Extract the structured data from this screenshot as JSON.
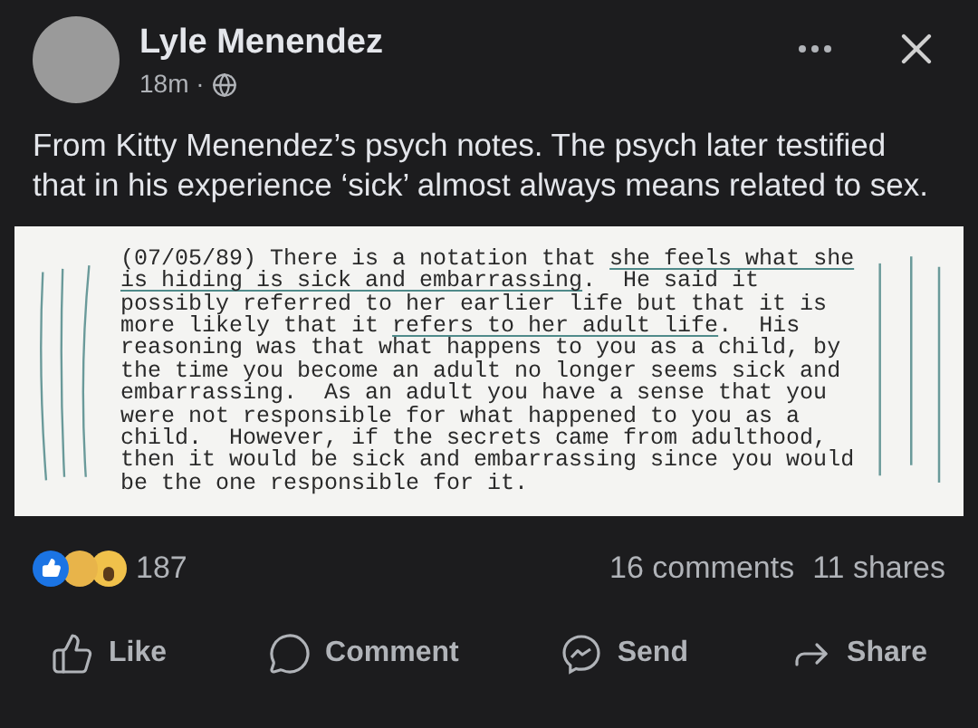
{
  "post": {
    "author": "Lyle Menendez",
    "time": "18m ·",
    "text": "From Kitty Menendez’s psych notes.  The psych later testified that in his experience ‘sick’ almost always means related to sex."
  },
  "document": {
    "lines": [
      [
        {
          "text": "(07/05/89) There is a notation that ",
          "underlined": false
        },
        {
          "text": "she feels what she",
          "underlined": true
        }
      ],
      [
        {
          "text": "is hiding is sick and embarrassing",
          "underlined": true
        },
        {
          "text": ".  He said it",
          "underlined": false
        }
      ],
      [
        {
          "text": "possibly referred to her earlier life but that it is",
          "underlined": false
        }
      ],
      [
        {
          "text": "more likely that it ",
          "underlined": false
        },
        {
          "text": "refers to her adult life",
          "underlined": true
        },
        {
          "text": ".  His",
          "underlined": false
        }
      ],
      [
        {
          "text": "reasoning was that what happens to you as a child, by",
          "underlined": false
        }
      ],
      [
        {
          "text": "the time you become an adult no longer seems sick and",
          "underlined": false
        }
      ],
      [
        {
          "text": "embarrassing.  As an adult you have a sense that you",
          "underlined": false
        }
      ],
      [
        {
          "text": "were not responsible for what happened to you as a",
          "underlined": false
        }
      ],
      [
        {
          "text": "child.  However, if the secrets came from adulthood,",
          "underlined": false
        }
      ],
      [
        {
          "text": "then it would be sick and embarrassing since you would",
          "underlined": false
        }
      ],
      [
        {
          "text": "be the one responsible for it.",
          "underlined": false
        }
      ]
    ]
  },
  "stats": {
    "reactions": "187",
    "comments": "16 comments",
    "shares": "11 shares"
  },
  "actions": [
    {
      "kind": "like",
      "label": "Like"
    },
    {
      "kind": "comment",
      "label": "Comment"
    },
    {
      "kind": "send",
      "label": "Send"
    },
    {
      "kind": "share",
      "label": "Share"
    }
  ]
}
